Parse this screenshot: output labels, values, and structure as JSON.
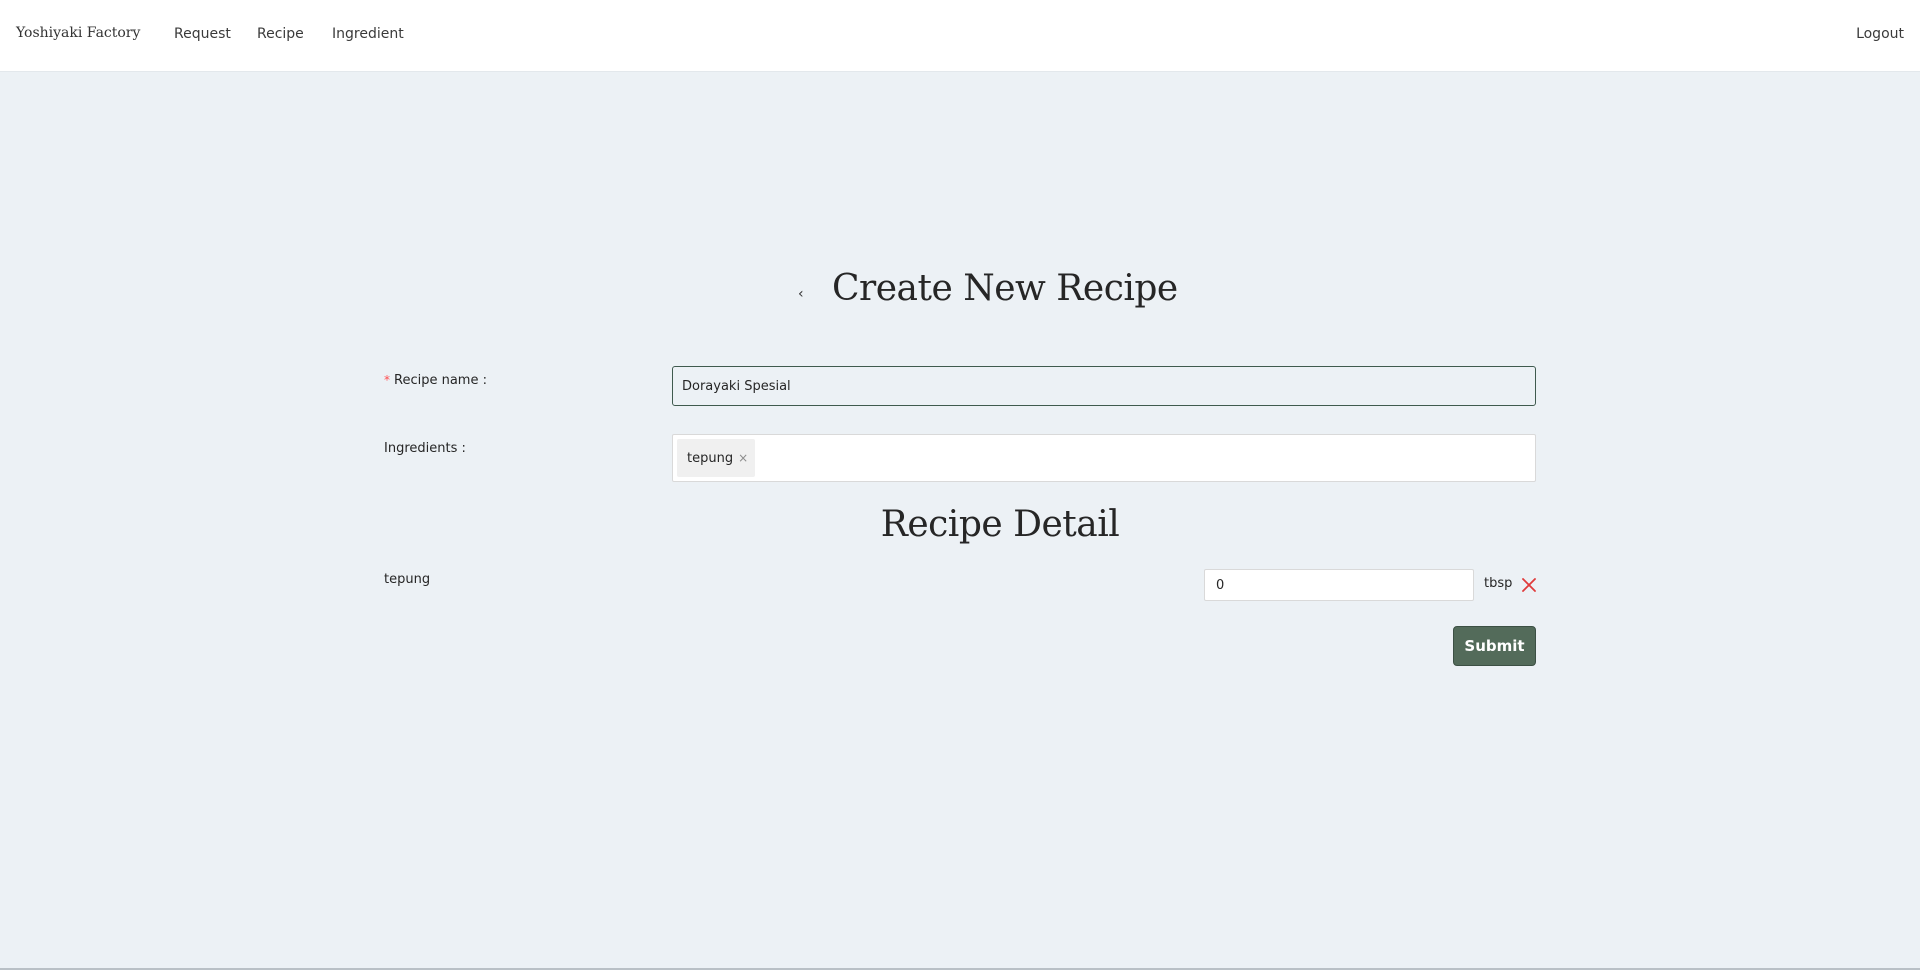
{
  "nav": {
    "brand": "Yoshiyaki Factory",
    "links": [
      "Request",
      "Recipe",
      "Ingredient"
    ],
    "logout": "Logout"
  },
  "page": {
    "back_icon": "chevron-left-icon",
    "title": "Create New Recipe"
  },
  "form": {
    "recipe_name_label": "Recipe name",
    "recipe_name_value": "Dorayaki Spesial",
    "ingredients_label": "Ingredients",
    "selected_ingredients": [
      "tepung"
    ],
    "tag_close_glyph": "×"
  },
  "recipe_detail": {
    "title": "Recipe Detail",
    "rows": [
      {
        "name": "tepung",
        "quantity": "0",
        "unit": "tbsp"
      }
    ]
  },
  "actions": {
    "submit_label": "Submit"
  },
  "colors": {
    "accent": "#536b5a",
    "background": "#ecf1f5",
    "remove": "#e03b3b",
    "required": "#ff4d4f"
  }
}
